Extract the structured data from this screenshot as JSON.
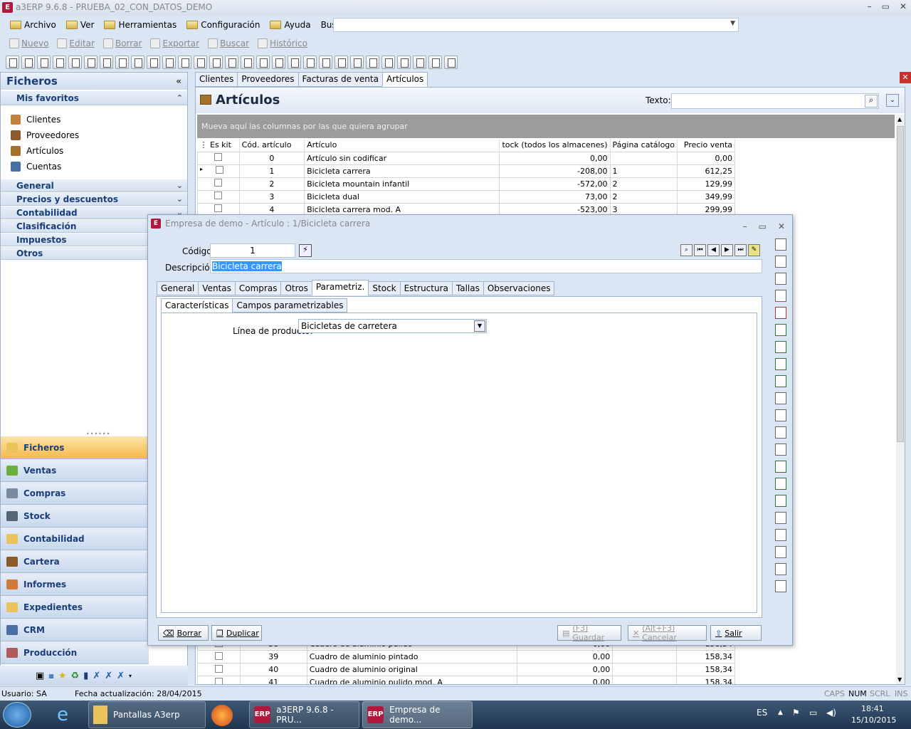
{
  "window": {
    "title": "a3ERP 9.6.8 - PRUEBA_02_CON_DATOS_DEMO"
  },
  "menu": {
    "items": [
      "Archivo",
      "Ver",
      "Herramientas",
      "Configuración",
      "Ayuda"
    ],
    "search_label": "Buscar opción:"
  },
  "toolbar": {
    "items": [
      "Nuevo",
      "Editar",
      "Borrar",
      "Exportar",
      "Buscar",
      "Histórico"
    ]
  },
  "left": {
    "title": "Ficheros",
    "collapse": "«",
    "favorites_title": "Mis favoritos",
    "favorites": [
      "Clientes",
      "Proveedores",
      "Artículos",
      "Cuentas"
    ],
    "sections": [
      "General",
      "Precios y descuentos",
      "Contabilidad",
      "Clasificación",
      "Impuestos",
      "Otros"
    ],
    "nav": [
      "Ficheros",
      "Ventas",
      "Compras",
      "Stock",
      "Contabilidad",
      "Cartera",
      "Informes",
      "Expedientes",
      "CRM",
      "Producción"
    ]
  },
  "tabs": [
    "Clientes",
    "Proveedores",
    "Facturas de venta",
    "Artículos"
  ],
  "articles": {
    "title": "Artículos",
    "search_label": "Texto:",
    "group_hint": "Mueva aquí las columnas por las que quiera agrupar",
    "columns": [
      "Es kit",
      "Cód. artículo",
      "Artículo",
      "tock (todos los almacenes)",
      "Página catálogo",
      "Precio venta"
    ],
    "rows": [
      {
        "code": "0",
        "name": "Artículo sin codificar",
        "stock": "0,00",
        "page": "",
        "price": "0,00"
      },
      {
        "code": "1",
        "name": "Bicicleta carrera",
        "stock": "-208,00",
        "page": "1",
        "price": "612,25"
      },
      {
        "code": "2",
        "name": "Bicicleta mountain infantil",
        "stock": "-572,00",
        "page": "2",
        "price": "129,99"
      },
      {
        "code": "3",
        "name": "Bicicleta dual",
        "stock": "73,00",
        "page": "2",
        "price": "349,99"
      },
      {
        "code": "4",
        "name": "Bicicleta carrera mod. A",
        "stock": "-523,00",
        "page": "3",
        "price": "299,99"
      }
    ],
    "bottom_rows": [
      {
        "code": "38",
        "name": "Cuadro de aluminio pulido",
        "stock": "0,00",
        "page": "",
        "price": "158,34"
      },
      {
        "code": "39",
        "name": "Cuadro de aluminio pintado",
        "stock": "0,00",
        "page": "",
        "price": "158,34"
      },
      {
        "code": "40",
        "name": "Cuadro de aluminio original",
        "stock": "0,00",
        "page": "",
        "price": "158,34"
      },
      {
        "code": "41",
        "name": "Cuadro de aluminio pulido mod. A",
        "stock": "0,00",
        "page": "",
        "price": "158,34"
      }
    ]
  },
  "dialog": {
    "title": "Empresa de demo - Artículo : 1/Bicicleta carrera",
    "code_label": "Código:",
    "code_value": "1",
    "desc_label": "Descripción:",
    "desc_value": "Bicicleta carrera",
    "tabs": [
      "General",
      "Ventas",
      "Compras",
      "Otros",
      "Parametriz.",
      "Stock",
      "Estructura",
      "Tallas",
      "Observaciones"
    ],
    "subtabs": [
      "Características",
      "Campos parametrizables"
    ],
    "line_label": "Línea de producto:",
    "line_value": "Bicicletas de carretera",
    "buttons": {
      "delete": "Borrar",
      "duplicate": "Duplicar",
      "save": "(F3) Guardar",
      "cancel": "(Alt+F3) Cancelar",
      "exit": "Salir"
    }
  },
  "status": {
    "user": "Usuario: SA",
    "updated": "Fecha actualización: 28/04/2015",
    "caps": "CAPS",
    "num": "NUM",
    "scrl": "SCRL",
    "ins": "INS"
  },
  "taskbar": {
    "items": [
      "Pantallas A3erp",
      "a3ERP 9.6.8 - PRU...",
      "Empresa de demo..."
    ],
    "erp": "ERP",
    "lang": "ES",
    "time": "18:41",
    "date": "15/10/2015"
  }
}
